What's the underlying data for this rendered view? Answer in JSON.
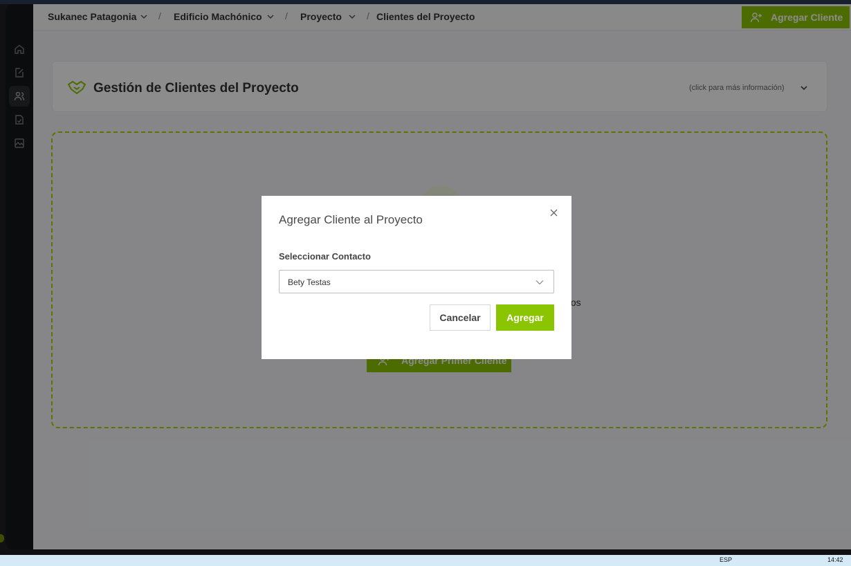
{
  "colors": {
    "accent": "#8bc400",
    "dropzone_border": "#a8d200",
    "overlay": "rgba(0,0,0,0.45)"
  },
  "sidebar": {
    "icons": [
      "home-icon",
      "edit-document-icon",
      "users-icon",
      "file-check-icon",
      "image-gallery-icon"
    ],
    "active": "users-icon"
  },
  "breadcrumb": {
    "items": [
      "Sukanec Patagonia",
      "Edificio Machónico",
      "Proyecto",
      "Clientes del Proyecto"
    ],
    "separator": "/"
  },
  "header": {
    "add_client_label": "Agregar Cliente"
  },
  "card": {
    "title": "Gestión de Clientes del Proyecto",
    "info": "(click para más información)"
  },
  "empty_state": {
    "text_fragment": "ctos",
    "first_client_label": "Agregar Primer Cliente"
  },
  "modal": {
    "title": "Agregar Cliente al Proyecto",
    "field_label": "Seleccionar Contacto",
    "selected_contact": "Bety Testas",
    "cancel_label": "Cancelar",
    "add_label": "Agregar"
  },
  "taskbar": {
    "lang": "ESP",
    "time": "14:42"
  }
}
